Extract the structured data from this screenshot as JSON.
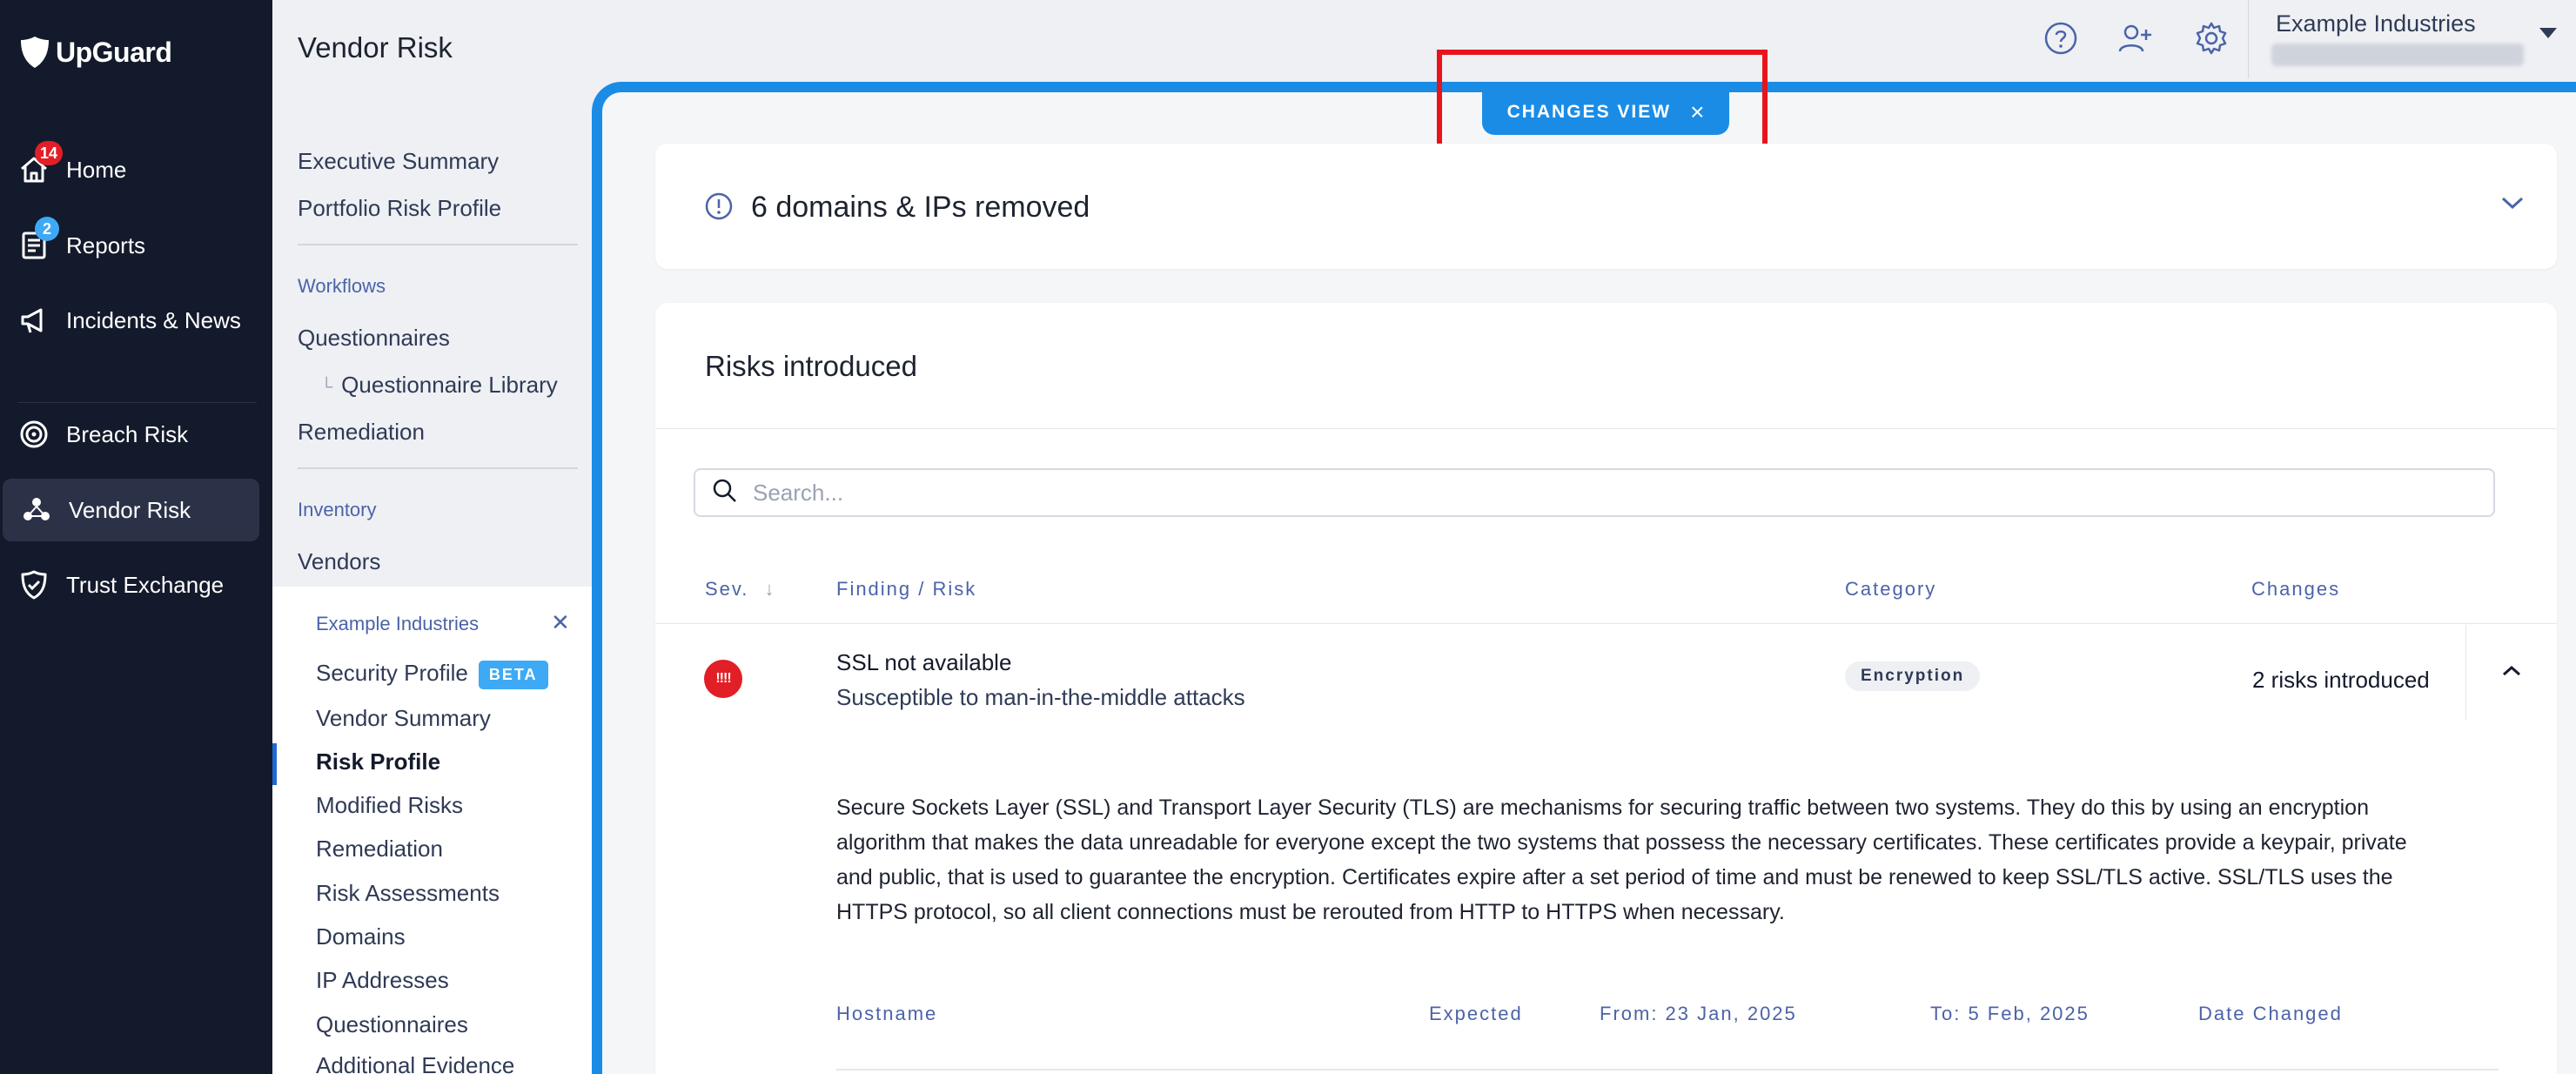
{
  "app": {
    "logo_text": "UpGuard"
  },
  "nav": {
    "items": [
      {
        "label": "Home",
        "badge": "14",
        "badge_color": "#e21e26",
        "icon": "home-icon"
      },
      {
        "label": "Reports",
        "badge": "2",
        "badge_color": "#3ea9f5",
        "icon": "reports-icon"
      },
      {
        "label": "Incidents & News",
        "badge": "",
        "icon": "megaphone-icon"
      },
      {
        "label": "Breach Risk",
        "badge": "",
        "icon": "target-icon"
      },
      {
        "label": "Vendor Risk",
        "badge": "",
        "icon": "vendor-icon",
        "active": true
      },
      {
        "label": "Trust Exchange",
        "badge": "",
        "icon": "shield-check-icon"
      }
    ]
  },
  "subnav": {
    "title": "Vendor Risk",
    "top_links": [
      "Executive Summary",
      "Portfolio Risk Profile"
    ],
    "workflows_heading": "Workflows",
    "workflows": [
      "Questionnaires",
      "Questionnaire Library",
      "Remediation"
    ],
    "inventory_heading": "Inventory",
    "inventory": [
      "Vendors"
    ],
    "vendor": {
      "name": "Example Industries",
      "items": [
        "Security Profile",
        "Vendor Summary",
        "Risk Profile",
        "Modified Risks",
        "Remediation",
        "Risk Assessments",
        "Domains",
        "IP Addresses",
        "Questionnaires",
        "Additional Evidence"
      ],
      "active_item": "Risk Profile",
      "beta_label": "BETA"
    }
  },
  "header": {
    "org_name": "Example Industries"
  },
  "changes_view": {
    "label": "CHANGES VIEW",
    "close": "×"
  },
  "removed_card": {
    "text": "6 domains & IPs removed"
  },
  "risks_card": {
    "title": "Risks introduced",
    "search_placeholder": "Search...",
    "columns": {
      "sev": "Sev.",
      "finding": "Finding / Risk",
      "category": "Category",
      "changes": "Changes"
    },
    "row": {
      "severity_glyph": "!!!!",
      "severity_color": "#e21e26",
      "title": "SSL not available",
      "subtitle": "Susceptible to man-in-the-middle attacks",
      "category": "Encryption",
      "changes": "2 risks introduced",
      "description": "Secure Sockets Layer (SSL) and Transport Layer Security (TLS) are mechanisms for securing traffic between two systems. They do this by using an encryption algorithm that makes the data unreadable for everyone except the two systems that possess the necessary certificates. These certificates provide a keypair, private and public, that is used to guarantee the encryption. Certificates expire after a set period of time and must be renewed to keep SSL/TLS active. SSL/TLS uses the HTTPS protocol, so all client connections must be rerouted from HTTP to HTTPS when necessary."
    },
    "detail_columns": {
      "hostname": "Hostname",
      "expected": "Expected",
      "from": "From: 23 Jan, 2025",
      "to": "To: 5 Feb, 2025",
      "date_changed": "Date Changed"
    }
  },
  "colors": {
    "accent": "#1a8ce6",
    "highlight": "#e8131c",
    "nav_bg": "#131a2b"
  }
}
